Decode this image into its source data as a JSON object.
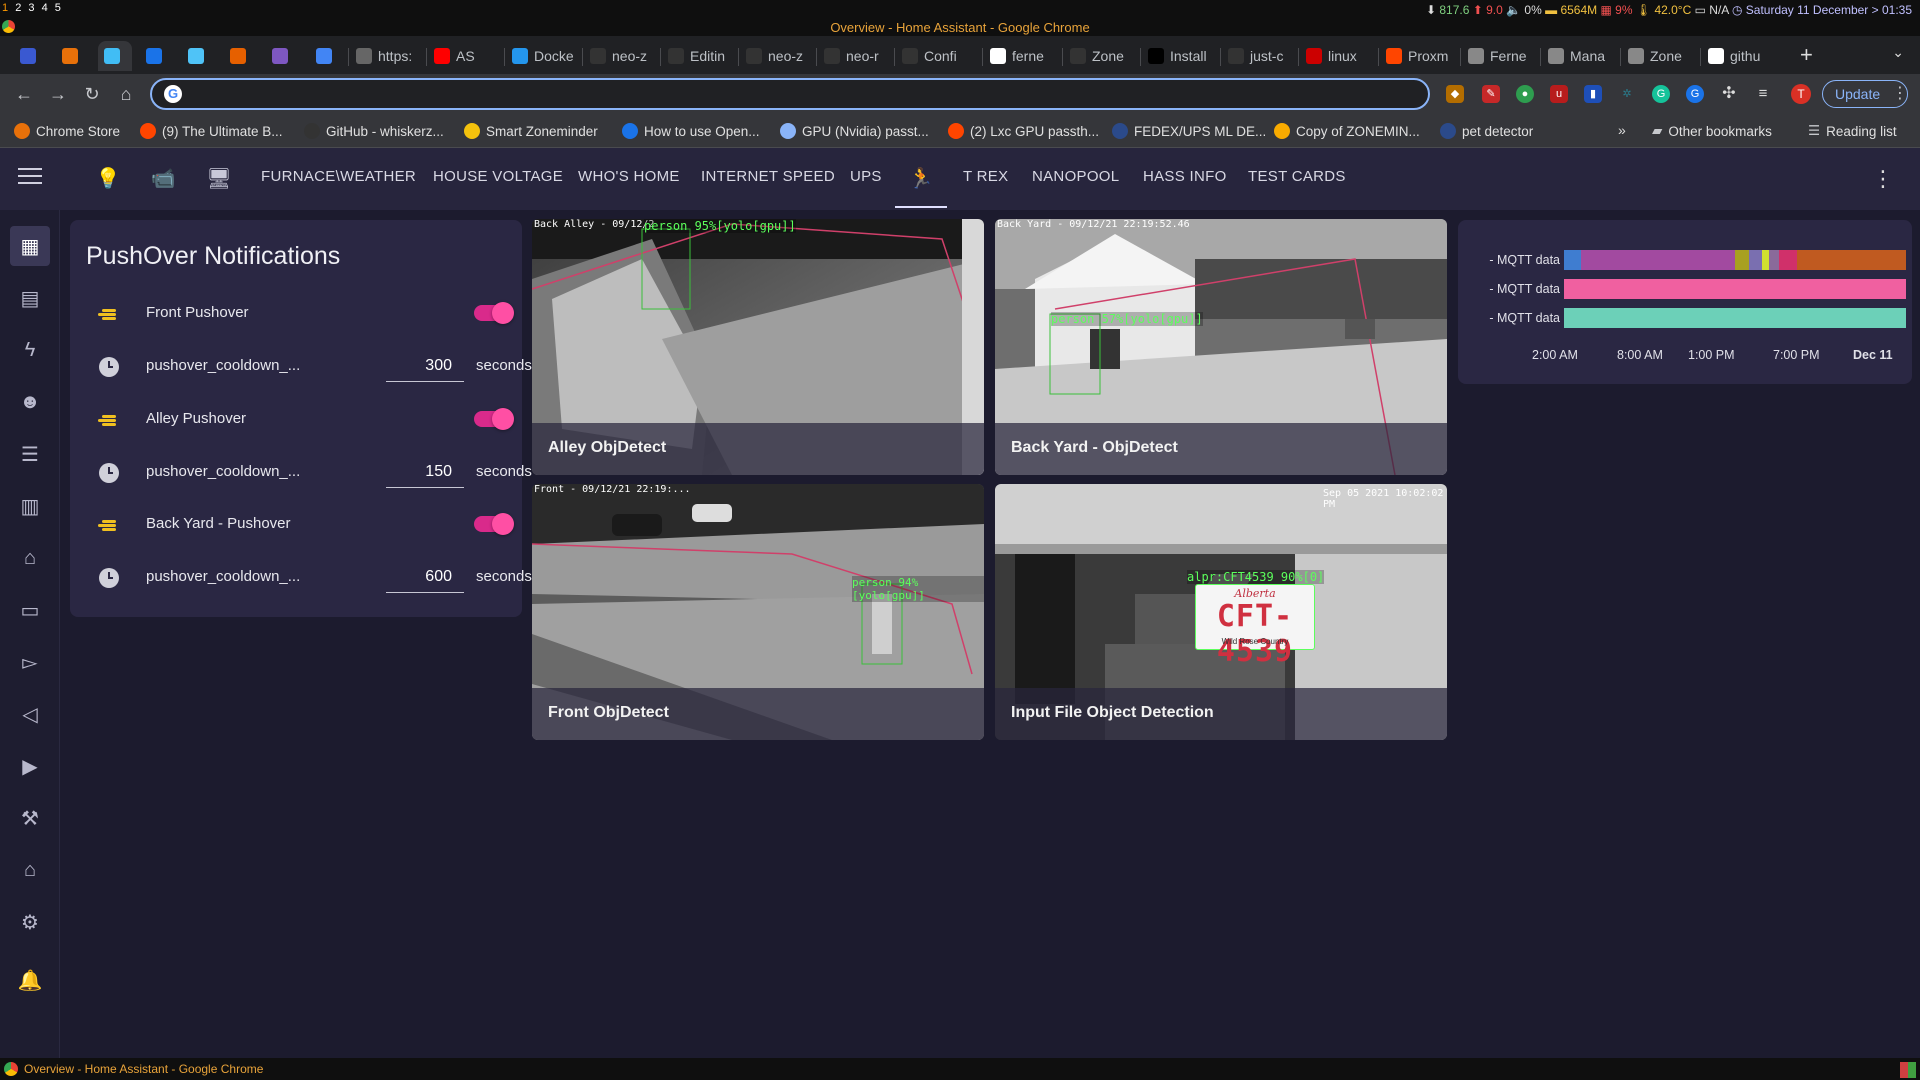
{
  "system": {
    "workspaces": [
      "1",
      "2",
      "3",
      "4",
      "5"
    ],
    "window_title": "Overview - Home Assistant - Google Chrome",
    "status": {
      "net": "817.6",
      "up": "9.0",
      "vol": "0%",
      "mem": "6564M",
      "cpu": "9%",
      "temp": "42.0°C",
      "bat": "N/A",
      "datetime": "Saturday 11 December > 01:35"
    }
  },
  "tabs": [
    {
      "label": "",
      "icon": "zm-icon",
      "color": "#3a59d1"
    },
    {
      "label": "",
      "icon": "x-icon",
      "color": "#e8710a"
    },
    {
      "label": "",
      "icon": "ha-icon",
      "color": "#41bdf5"
    },
    {
      "label": "",
      "icon": "p-icon",
      "color": "#1a73e8"
    },
    {
      "label": "",
      "icon": "cube-icon",
      "color": "#4fc3f7"
    },
    {
      "label": "",
      "icon": "firefox-icon",
      "color": "#e66000"
    },
    {
      "label": "",
      "icon": "shield-icon",
      "color": "#7e57c2"
    },
    {
      "label": "",
      "icon": "web-icon",
      "color": "#4285f4"
    },
    {
      "label": "https:",
      "icon": "globe-icon",
      "color": "#666"
    },
    {
      "label": "AS",
      "icon": "youtube-icon",
      "color": "#ff0000"
    },
    {
      "label": "Docke",
      "icon": "docker-icon",
      "color": "#2496ed"
    },
    {
      "label": "neo-z",
      "icon": "github-icon",
      "color": "#333"
    },
    {
      "label": "Editin",
      "icon": "github-icon",
      "color": "#333"
    },
    {
      "label": "neo-z",
      "icon": "github-icon",
      "color": "#333"
    },
    {
      "label": "neo-r",
      "icon": "github-icon",
      "color": "#333"
    },
    {
      "label": "Confi",
      "icon": "github-icon",
      "color": "#333"
    },
    {
      "label": "ferne",
      "icon": "google-icon",
      "color": "#fff"
    },
    {
      "label": "Zone",
      "icon": "github-icon",
      "color": "#333"
    },
    {
      "label": "Install",
      "icon": "medium-icon",
      "color": "#000"
    },
    {
      "label": "just-c",
      "icon": "github-icon",
      "color": "#333"
    },
    {
      "label": "linux",
      "icon": "flag-icon",
      "color": "#c00"
    },
    {
      "label": "Proxm",
      "icon": "reddit-icon",
      "color": "#ff4500"
    },
    {
      "label": "Ferne",
      "icon": "doc-icon",
      "color": "#888"
    },
    {
      "label": "Mana",
      "icon": "doc-icon",
      "color": "#888"
    },
    {
      "label": "Zone",
      "icon": "doc-icon",
      "color": "#888"
    },
    {
      "label": "githu",
      "icon": "google-icon",
      "color": "#fff"
    }
  ],
  "toolbar": {
    "update_label": "Update",
    "avatar_letter": "T"
  },
  "bookmarks": [
    {
      "label": "Chrome Store",
      "color": "#e8710a"
    },
    {
      "label": "(9) The Ultimate B...",
      "color": "#ff4500"
    },
    {
      "label": "GitHub - whiskerz...",
      "color": "#333"
    },
    {
      "label": "Smart Zoneminder",
      "color": "#f4c20d"
    },
    {
      "label": "How to use Open...",
      "color": "#1a73e8"
    },
    {
      "label": "GPU (Nvidia) passt...",
      "color": "#8ab4f8"
    },
    {
      "label": "(2) Lxc GPU passth...",
      "color": "#ff4500"
    },
    {
      "label": "FEDEX/UPS ML DE...",
      "color": "#2b4a8a"
    },
    {
      "label": "Copy of ZONEMIN...",
      "color": "#f9ab00"
    },
    {
      "label": "pet detector",
      "color": "#2b4a8a"
    }
  ],
  "bookmarks_more": "»",
  "bookmarks_right": {
    "other": "Other bookmarks",
    "reading": "Reading list"
  },
  "ha": {
    "views": [
      "FURNACE\\WEATHER",
      "HOUSE VOLTAGE",
      "WHO'S HOME",
      "INTERNET SPEED",
      "UPS",
      "T REX",
      "NANOPOOL",
      "HASS INFO",
      "TEST CARDS"
    ],
    "active_view_icon": "motion-person-icon",
    "sidebar": [
      "overview-icon",
      "dashboard-icon",
      "energy-icon",
      "person-icon",
      "logbook-icon",
      "history-icon",
      "hacs-icon",
      "notes-icon",
      "terminal-icon",
      "vscode-icon",
      "media-icon",
      "developer-tools-icon",
      "house-icon",
      "config-icon",
      "notifications-icon"
    ]
  },
  "pushover": {
    "title": "PushOver Notifications",
    "rows": [
      {
        "type": "toggle",
        "name": "Front Pushover",
        "on": true
      },
      {
        "type": "number",
        "name": "pushover_cooldown_...",
        "value": "300",
        "unit": "seconds"
      },
      {
        "type": "toggle",
        "name": "Alley Pushover",
        "on": true
      },
      {
        "type": "number",
        "name": "pushover_cooldown_...",
        "value": "150",
        "unit": "seconds"
      },
      {
        "type": "toggle",
        "name": "Back Yard - Pushover",
        "on": true
      },
      {
        "type": "number",
        "name": "pushover_cooldown_...",
        "value": "600",
        "unit": "seconds"
      }
    ]
  },
  "cameras": [
    {
      "caption": "Alley ObjDetect",
      "timestamp": "Back Alley - 09/12/2",
      "detection": "person 95%[yolo[gpu]]"
    },
    {
      "caption": "Back Yard - ObjDetect",
      "timestamp": "Back Yard - 09/12/21 22:19:52.46",
      "detection": "person 57%[yolo[gpu]]"
    },
    {
      "caption": "Front ObjDetect",
      "timestamp": "Front - 09/12/21 22:19:...",
      "detection": "person 94%[yolo[gpu]]"
    },
    {
      "caption": "Input File Object Detection",
      "timestamp": "Sep 05 2021   10:02:02 PM",
      "detection": "alpr:CFT4539 90%[0]",
      "plate_text": "CFT-4539",
      "plate_region": "Alberta",
      "plate_tag": "Wild Rose Country"
    }
  ],
  "history": {
    "rows": [
      {
        "label": "- MQTT data",
        "segments": [
          {
            "w": 5,
            "c": "#3f7dd0"
          },
          {
            "w": 45,
            "c": "#a24aa0"
          },
          {
            "w": 4,
            "c": "#a8a020"
          },
          {
            "w": 4,
            "c": "#7a6fb0"
          },
          {
            "w": 2,
            "c": "#d0e030"
          },
          {
            "w": 3,
            "c": "#8a6a9a"
          },
          {
            "w": 5,
            "c": "#d0306a"
          },
          {
            "w": 32,
            "c": "#c05a20"
          }
        ]
      },
      {
        "label": "- MQTT data",
        "segments": [
          {
            "w": 100,
            "c": "#f060a0"
          }
        ]
      },
      {
        "label": "- MQTT data",
        "segments": [
          {
            "w": 100,
            "c": "#6cd0b8"
          }
        ]
      }
    ],
    "axis": [
      "2:00 AM",
      "8:00 AM",
      "1:00 PM",
      "7:00 PM",
      "Dec 11"
    ]
  },
  "taskbar": {
    "title": "Overview - Home Assistant - Google Chrome"
  }
}
